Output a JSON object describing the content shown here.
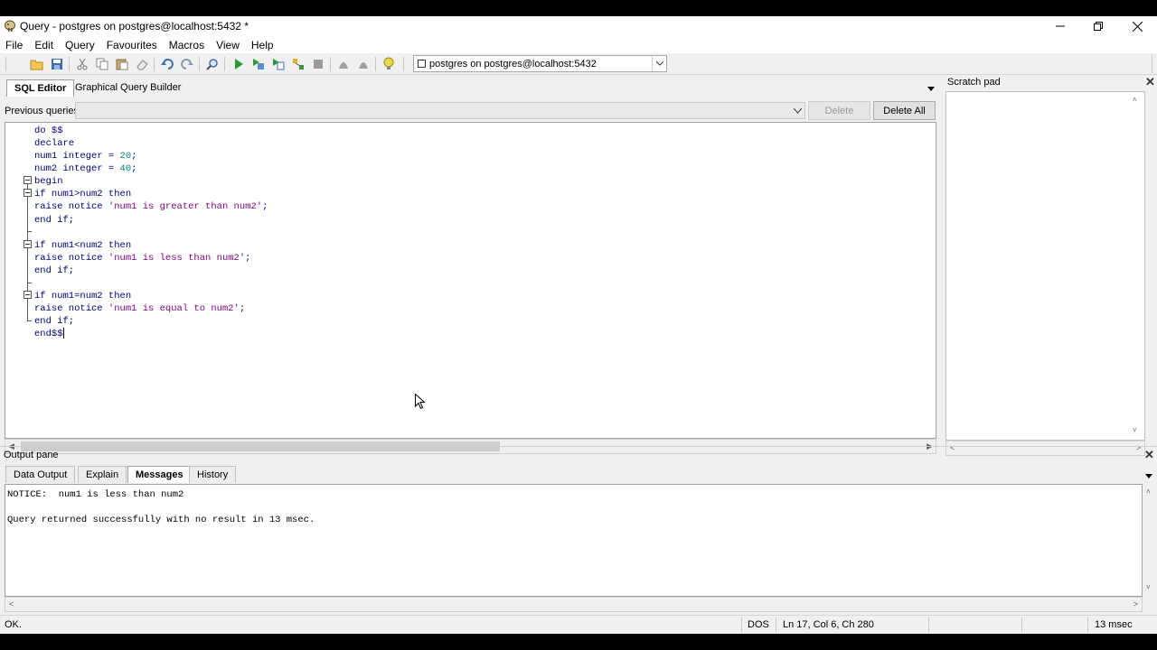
{
  "window": {
    "title": "Query - postgres on postgres@localhost:5432 *"
  },
  "menu": [
    "File",
    "Edit",
    "Query",
    "Favourites",
    "Macros",
    "View",
    "Help"
  ],
  "toolbar": {
    "connection": "postgres on postgres@localhost:5432"
  },
  "editor_tabs": {
    "sql_editor": "SQL Editor",
    "query_builder": "Graphical Query Builder"
  },
  "previous_queries": {
    "label": "Previous queries",
    "value": "",
    "delete_label": "Delete",
    "delete_all_label": "Delete All"
  },
  "code": {
    "lines": [
      "do $$",
      "declare",
      "num1 integer = 20;",
      "num2 integer = 40;",
      "begin",
      "if num1>num2 then",
      "raise notice 'num1 is greater than num2';",
      "end if;",
      "",
      "if num1<num2 then",
      "raise notice 'num1 is less than num2';",
      "end if;",
      "",
      "if num1=num2 then",
      "raise notice 'num1 is equal to num2';",
      "end if;",
      "end$$"
    ]
  },
  "scratch_pad": {
    "title": "Scratch pad"
  },
  "output": {
    "title": "Output pane",
    "tabs": [
      "Data Output",
      "Explain",
      "Messages",
      "History"
    ],
    "active_tab": "Messages",
    "messages": [
      "NOTICE:  num1 is less than num2",
      "",
      "Query returned successfully with no result in 13 msec."
    ]
  },
  "status": {
    "state": "OK.",
    "line_ending": "DOS",
    "position": "Ln 17, Col 6, Ch 280",
    "elapsed": "13 msec"
  }
}
